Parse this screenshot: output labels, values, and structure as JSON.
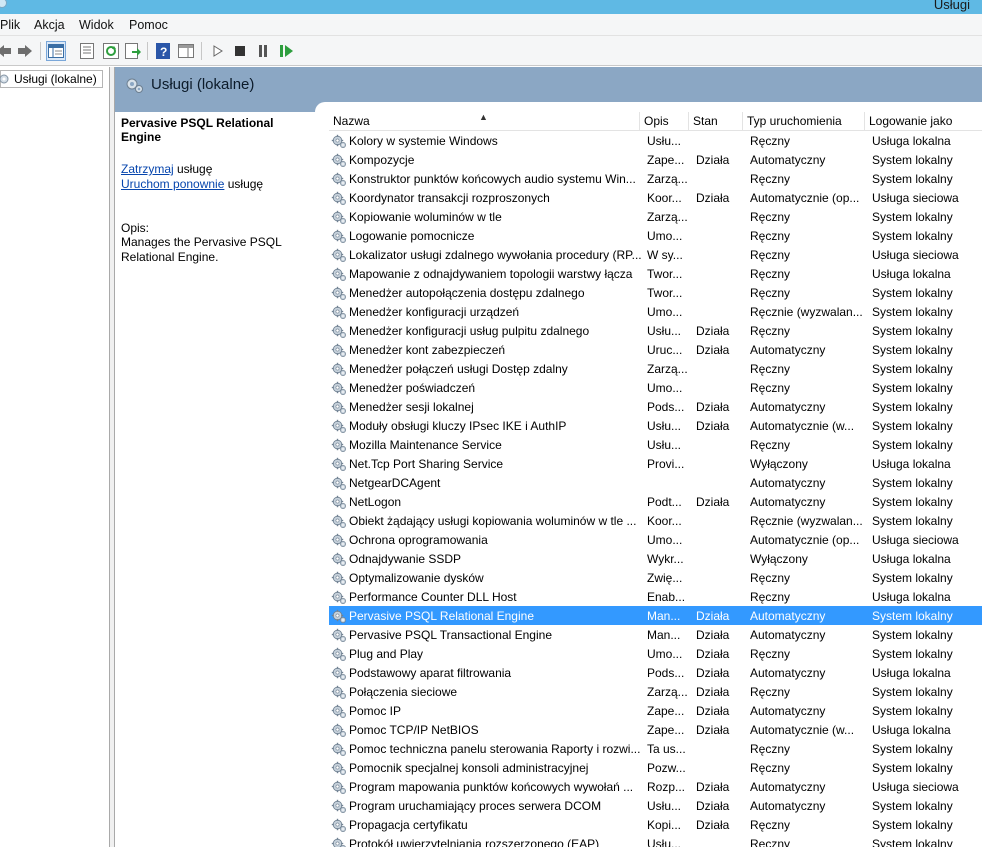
{
  "window": {
    "title": "Usługi"
  },
  "menu": [
    "Plik",
    "Akcja",
    "Widok",
    "Pomoc"
  ],
  "toolbar": {
    "icons": [
      "back-arrow-icon",
      "forward-arrow-icon",
      "show-hide-console-tree-icon",
      "properties-icon",
      "refresh-icon",
      "export-list-icon",
      "help-icon",
      "show-hide-action-pane-icon",
      "start-service-icon",
      "stop-service-icon",
      "pause-service-icon",
      "restart-service-icon"
    ]
  },
  "tree": {
    "item_label": "Usługi (lokalne)"
  },
  "main": {
    "header_title": "Usługi (lokalne)"
  },
  "description": {
    "service_name": "Pervasive PSQL Relational Engine",
    "stop_link": "Zatrzymaj",
    "stop_suffix": " usługę",
    "restart_link": "Uruchom ponownie",
    "restart_suffix": " usługę",
    "opis_label": "Opis:",
    "opis_text": "Manages the Pervasive PSQL Relational Engine."
  },
  "columns": {
    "name": "Nazwa",
    "opis": "Opis",
    "stan": "Stan",
    "typ": "Typ uruchomienia",
    "log": "Logowanie jako"
  },
  "rows": [
    {
      "name": "Kolory w systemie Windows",
      "opis": "Usłu...",
      "stan": "",
      "typ": "Ręczny",
      "log": "Usługa lokalna"
    },
    {
      "name": "Kompozycje",
      "opis": "Zape...",
      "stan": "Działa",
      "typ": "Automatyczny",
      "log": "System lokalny"
    },
    {
      "name": "Konstruktor punktów końcowych audio systemu Win...",
      "opis": "Zarzą...",
      "stan": "",
      "typ": "Ręczny",
      "log": "System lokalny"
    },
    {
      "name": "Koordynator transakcji rozproszonych",
      "opis": "Koor...",
      "stan": "Działa",
      "typ": "Automatycznie (op...",
      "log": "Usługa sieciowa"
    },
    {
      "name": "Kopiowanie woluminów w tle",
      "opis": "Zarzą...",
      "stan": "",
      "typ": "Ręczny",
      "log": "System lokalny"
    },
    {
      "name": "Logowanie pomocnicze",
      "opis": "Umo...",
      "stan": "",
      "typ": "Ręczny",
      "log": "System lokalny"
    },
    {
      "name": "Lokalizator usługi zdalnego wywołania procedury (RP...",
      "opis": "W sy...",
      "stan": "",
      "typ": "Ręczny",
      "log": "Usługa sieciowa"
    },
    {
      "name": "Mapowanie z odnajdywaniem topologii warstwy łącza",
      "opis": "Twor...",
      "stan": "",
      "typ": "Ręczny",
      "log": "Usługa lokalna"
    },
    {
      "name": "Menedżer autopołączenia dostępu zdalnego",
      "opis": "Twor...",
      "stan": "",
      "typ": "Ręczny",
      "log": "System lokalny"
    },
    {
      "name": "Menedżer konfiguracji urządzeń",
      "opis": "Umo...",
      "stan": "",
      "typ": "Ręcznie (wyzwalan...",
      "log": "System lokalny"
    },
    {
      "name": "Menedżer konfiguracji usług pulpitu zdalnego",
      "opis": "Usłu...",
      "stan": "Działa",
      "typ": "Ręczny",
      "log": "System lokalny"
    },
    {
      "name": "Menedżer kont zabezpieczeń",
      "opis": "Uruc...",
      "stan": "Działa",
      "typ": "Automatyczny",
      "log": "System lokalny"
    },
    {
      "name": "Menedżer połączeń usługi Dostęp zdalny",
      "opis": "Zarzą...",
      "stan": "",
      "typ": "Ręczny",
      "log": "System lokalny"
    },
    {
      "name": "Menedżer poświadczeń",
      "opis": "Umo...",
      "stan": "",
      "typ": "Ręczny",
      "log": "System lokalny"
    },
    {
      "name": "Menedżer sesji lokalnej",
      "opis": "Pods...",
      "stan": "Działa",
      "typ": "Automatyczny",
      "log": "System lokalny"
    },
    {
      "name": "Moduły obsługi kluczy IPsec IKE i AuthIP",
      "opis": "Usłu...",
      "stan": "Działa",
      "typ": "Automatycznie (w...",
      "log": "System lokalny"
    },
    {
      "name": "Mozilla Maintenance Service",
      "opis": "Usłu...",
      "stan": "",
      "typ": "Ręczny",
      "log": "System lokalny"
    },
    {
      "name": "Net.Tcp Port Sharing Service",
      "opis": "Provi...",
      "stan": "",
      "typ": "Wyłączony",
      "log": "Usługa lokalna"
    },
    {
      "name": "NetgearDCAgent",
      "opis": "",
      "stan": "",
      "typ": "Automatyczny",
      "log": "System lokalny"
    },
    {
      "name": "NetLogon",
      "opis": "Podt...",
      "stan": "Działa",
      "typ": "Automatyczny",
      "log": "System lokalny"
    },
    {
      "name": "Obiekt żądający usługi kopiowania woluminów w tle ...",
      "opis": "Koor...",
      "stan": "",
      "typ": "Ręcznie (wyzwalan...",
      "log": "System lokalny"
    },
    {
      "name": "Ochrona oprogramowania",
      "opis": "Umo...",
      "stan": "",
      "typ": "Automatycznie (op...",
      "log": "Usługa sieciowa"
    },
    {
      "name": "Odnajdywanie SSDP",
      "opis": "Wykr...",
      "stan": "",
      "typ": "Wyłączony",
      "log": "Usługa lokalna"
    },
    {
      "name": "Optymalizowanie dysków",
      "opis": "Zwię...",
      "stan": "",
      "typ": "Ręczny",
      "log": "System lokalny"
    },
    {
      "name": "Performance Counter DLL Host",
      "opis": "Enab...",
      "stan": "",
      "typ": "Ręczny",
      "log": "Usługa lokalna"
    },
    {
      "name": "Pervasive PSQL Relational Engine",
      "opis": "Man...",
      "stan": "Działa",
      "typ": "Automatyczny",
      "log": "System lokalny",
      "selected": true
    },
    {
      "name": "Pervasive PSQL Transactional Engine",
      "opis": "Man...",
      "stan": "Działa",
      "typ": "Automatyczny",
      "log": "System lokalny"
    },
    {
      "name": "Plug and Play",
      "opis": "Umo...",
      "stan": "Działa",
      "typ": "Ręczny",
      "log": "System lokalny"
    },
    {
      "name": "Podstawowy aparat filtrowania",
      "opis": "Pods...",
      "stan": "Działa",
      "typ": "Automatyczny",
      "log": "Usługa lokalna"
    },
    {
      "name": "Połączenia sieciowe",
      "opis": "Zarzą...",
      "stan": "Działa",
      "typ": "Ręczny",
      "log": "System lokalny"
    },
    {
      "name": "Pomoc IP",
      "opis": "Zape...",
      "stan": "Działa",
      "typ": "Automatyczny",
      "log": "System lokalny"
    },
    {
      "name": "Pomoc TCP/IP NetBIOS",
      "opis": "Zape...",
      "stan": "Działa",
      "typ": "Automatycznie (w...",
      "log": "Usługa lokalna"
    },
    {
      "name": "Pomoc techniczna panelu sterowania Raporty i rozwi...",
      "opis": "Ta us...",
      "stan": "",
      "typ": "Ręczny",
      "log": "System lokalny"
    },
    {
      "name": "Pomocnik specjalnej konsoli administracyjnej",
      "opis": "Pozw...",
      "stan": "",
      "typ": "Ręczny",
      "log": "System lokalny"
    },
    {
      "name": "Program mapowania punktów końcowych wywołań ...",
      "opis": "Rozp...",
      "stan": "Działa",
      "typ": "Automatyczny",
      "log": "Usługa sieciowa"
    },
    {
      "name": "Program uruchamiający proces serwera DCOM",
      "opis": "Usłu...",
      "stan": "Działa",
      "typ": "Automatyczny",
      "log": "System lokalny"
    },
    {
      "name": "Propagacja certyfikatu",
      "opis": "Kopi...",
      "stan": "Działa",
      "typ": "Ręczny",
      "log": "System lokalny"
    },
    {
      "name": "Protokół uwierzytelniania rozszerzonego (EAP)",
      "opis": "Usłu...",
      "stan": "",
      "typ": "Ręczny",
      "log": "System lokalny"
    }
  ],
  "colors": {
    "selection": "#3399ff",
    "header_band": "#8ba7c4",
    "titlebar": "#5fb9e4",
    "link": "#0645ad"
  }
}
